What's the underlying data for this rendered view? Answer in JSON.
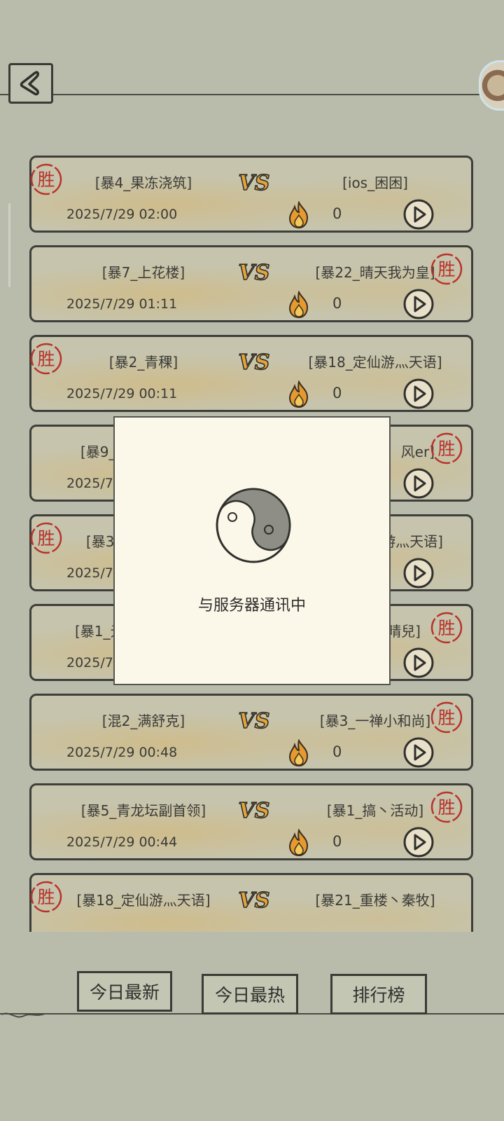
{
  "header": {
    "back_icon": "back-arrow-icon"
  },
  "matches": [
    {
      "player1": "[暴4_果冻浇筑]",
      "player2": "[ios_困困]",
      "date": "2025/7/29 02:00",
      "heat": "0",
      "winner_side": "left"
    },
    {
      "player1": "[暴7_上花楼]",
      "player2": "[暴22_晴天我为皇]",
      "date": "2025/7/29 01:11",
      "heat": "0",
      "winner_side": "right"
    },
    {
      "player1": "[暴2_青稞]",
      "player2": "[暴18_定仙游灬天语]",
      "date": "2025/7/29 00:11",
      "heat": "0",
      "winner_side": "left"
    },
    {
      "player1": "[暴9_",
      "player2": "风er]",
      "date": "2025/7/",
      "heat": "",
      "winner_side": "right"
    },
    {
      "player1": "[暴3",
      "player2": "游灬天语]",
      "date": "2025/7/",
      "heat": "",
      "winner_side": "left"
    },
    {
      "player1": "[暴1_元",
      "player2": "晴兒]",
      "date": "2025/7/",
      "heat": "",
      "winner_side": "right"
    },
    {
      "player1": "[混2_满舒克]",
      "player2": "[暴3_一禅小和尚]",
      "date": "2025/7/29 00:48",
      "heat": "0",
      "winner_side": "right"
    },
    {
      "player1": "[暴5_青龙坛副首领]",
      "player2": "[暴1_搞丶活动]",
      "date": "2025/7/29 00:44",
      "heat": "0",
      "winner_side": "right"
    },
    {
      "player1": "[暴18_定仙游灬天语]",
      "player2": "[暴21_重楼丶秦牧]",
      "date": "",
      "heat": "",
      "winner_side": "left"
    }
  ],
  "win_stamp_text": "胜",
  "modal": {
    "icon": "taiji-icon",
    "message": "与服务器通讯中"
  },
  "tabs": {
    "latest": "今日最新",
    "hottest": "今日最热",
    "ranking": "排行榜"
  },
  "colors": {
    "background": "#b9bcab",
    "stamp_red": "#b8322a",
    "accent_gold": "#d89a2e",
    "modal_bg": "#fbf7e9"
  }
}
